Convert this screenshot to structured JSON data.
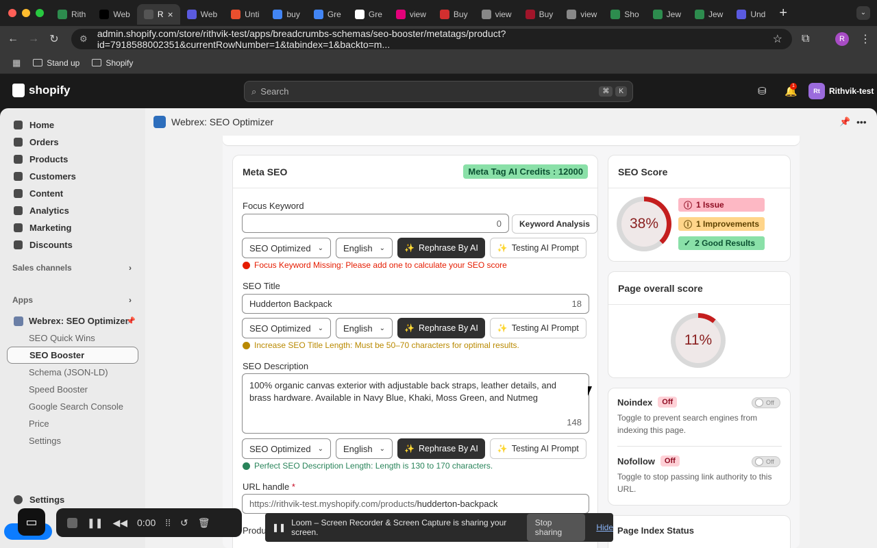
{
  "browser": {
    "tabs": [
      {
        "label": "Rith",
        "color": "#2d8c4e"
      },
      {
        "label": "Web",
        "color": "#000000"
      },
      {
        "label": "R",
        "color": "#555555"
      },
      {
        "label": "Web",
        "color": "#5a5ae0"
      },
      {
        "label": "Unti",
        "color": "#e94f2e"
      },
      {
        "label": "buy",
        "color": "#4285f4"
      },
      {
        "label": "Gre",
        "color": "#4285f4"
      },
      {
        "label": "Gre",
        "color": "#ffffff"
      },
      {
        "label": "view",
        "color": "#e3007a"
      },
      {
        "label": "Buy",
        "color": "#d32f2f"
      },
      {
        "label": "view",
        "color": "#888888"
      },
      {
        "label": "Buy",
        "color": "#a0152a"
      },
      {
        "label": "view",
        "color": "#888888"
      },
      {
        "label": "Sho",
        "color": "#2d8c4e"
      },
      {
        "label": "Jew",
        "color": "#2d8c4e"
      },
      {
        "label": "Jew",
        "color": "#2d8c4e"
      },
      {
        "label": "Und",
        "color": "#5a5ae0"
      }
    ],
    "url": "admin.shopify.com/store/rithvik-test/apps/breadcrumbs-schemas/seo-booster/metatags/product?id=7918588002351&currentRowNumber=1&tabindex=1&backto=m...",
    "profile_initial": "R",
    "bookmarks": [
      "Stand up",
      "Shopify"
    ]
  },
  "shopify": {
    "search_placeholder": "Search",
    "shortcut": [
      "⌘",
      "K"
    ],
    "notification_count": "1",
    "store_initials": "Rt",
    "store_name": "Rithvik-test",
    "nav": [
      "Home",
      "Orders",
      "Products",
      "Customers",
      "Content",
      "Analytics",
      "Marketing",
      "Discounts"
    ],
    "sales_channels": "Sales channels",
    "apps": "Apps",
    "app_name": "Webrex: SEO Optimizer",
    "app_subnav": [
      "SEO Quick Wins",
      "SEO Booster",
      "Schema (JSON-LD)",
      "Speed Booster",
      "Google Search Console",
      "Price",
      "Settings"
    ],
    "settings": "Settings"
  },
  "app": {
    "header_title": "Webrex: SEO Optimizer",
    "meta_seo": {
      "title": "Meta SEO",
      "credits": "Meta Tag AI Credits : 12000",
      "focus_keyword": {
        "label": "Focus Keyword",
        "value": "",
        "count": "0",
        "analysis_button": "Keyword Analysis"
      },
      "controls": {
        "mode": "SEO Optimized",
        "language": "English",
        "rephrase": "Rephrase By AI",
        "testing": "Testing AI Prompt"
      },
      "focus_msg": "Focus Keyword Missing: Please add one to calculate your SEO score",
      "seo_title": {
        "label": "SEO Title",
        "value": "Hudderton Backpack",
        "count": "18"
      },
      "title_msg": "Increase SEO Title Length: Must be 50–70 characters for optimal results.",
      "seo_description": {
        "label": "SEO Description",
        "value": "100% organic canvas exterior with adjustable back straps, leather details, and brass hardware. Available in Navy Blue, Khaki, Moss Green, and Nutmeg",
        "count": "148"
      },
      "desc_msg": "Perfect SEO Description Length: Length is 130 to 170 characters.",
      "url_handle": {
        "label": "URL handle",
        "required": "*",
        "prefix": "https://rithvik-test.myshopify.com/products/",
        "value": "hudderton-backpack"
      },
      "next_label": "Produ"
    },
    "seo_score": {
      "title": "SEO Score",
      "value": "38%",
      "fraction": 0.38,
      "issues": "1 Issue",
      "improvements": "1 Improvements",
      "good": "2 Good Results"
    },
    "page_score": {
      "title": "Page overall score",
      "value": "11%",
      "fraction": 0.11
    },
    "noindex": {
      "label": "Noindex",
      "badge": "Off",
      "toggle": "Off",
      "desc": "Toggle to prevent search engines from indexing this page."
    },
    "nofollow": {
      "label": "Nofollow",
      "badge": "Off",
      "toggle": "Off",
      "desc": "Toggle to stop passing link authority to this URL."
    },
    "page_index_status": "Page Index Status"
  },
  "loom": {
    "timer": "0:00",
    "share_msg": "Loom – Screen Recorder & Screen Capture is sharing your screen.",
    "stop": "Stop sharing",
    "hide": "Hide"
  },
  "colors": {
    "accent_green": "#8ae0a8",
    "error": "#e51c00",
    "warning": "#b98900",
    "success": "#29845a"
  }
}
